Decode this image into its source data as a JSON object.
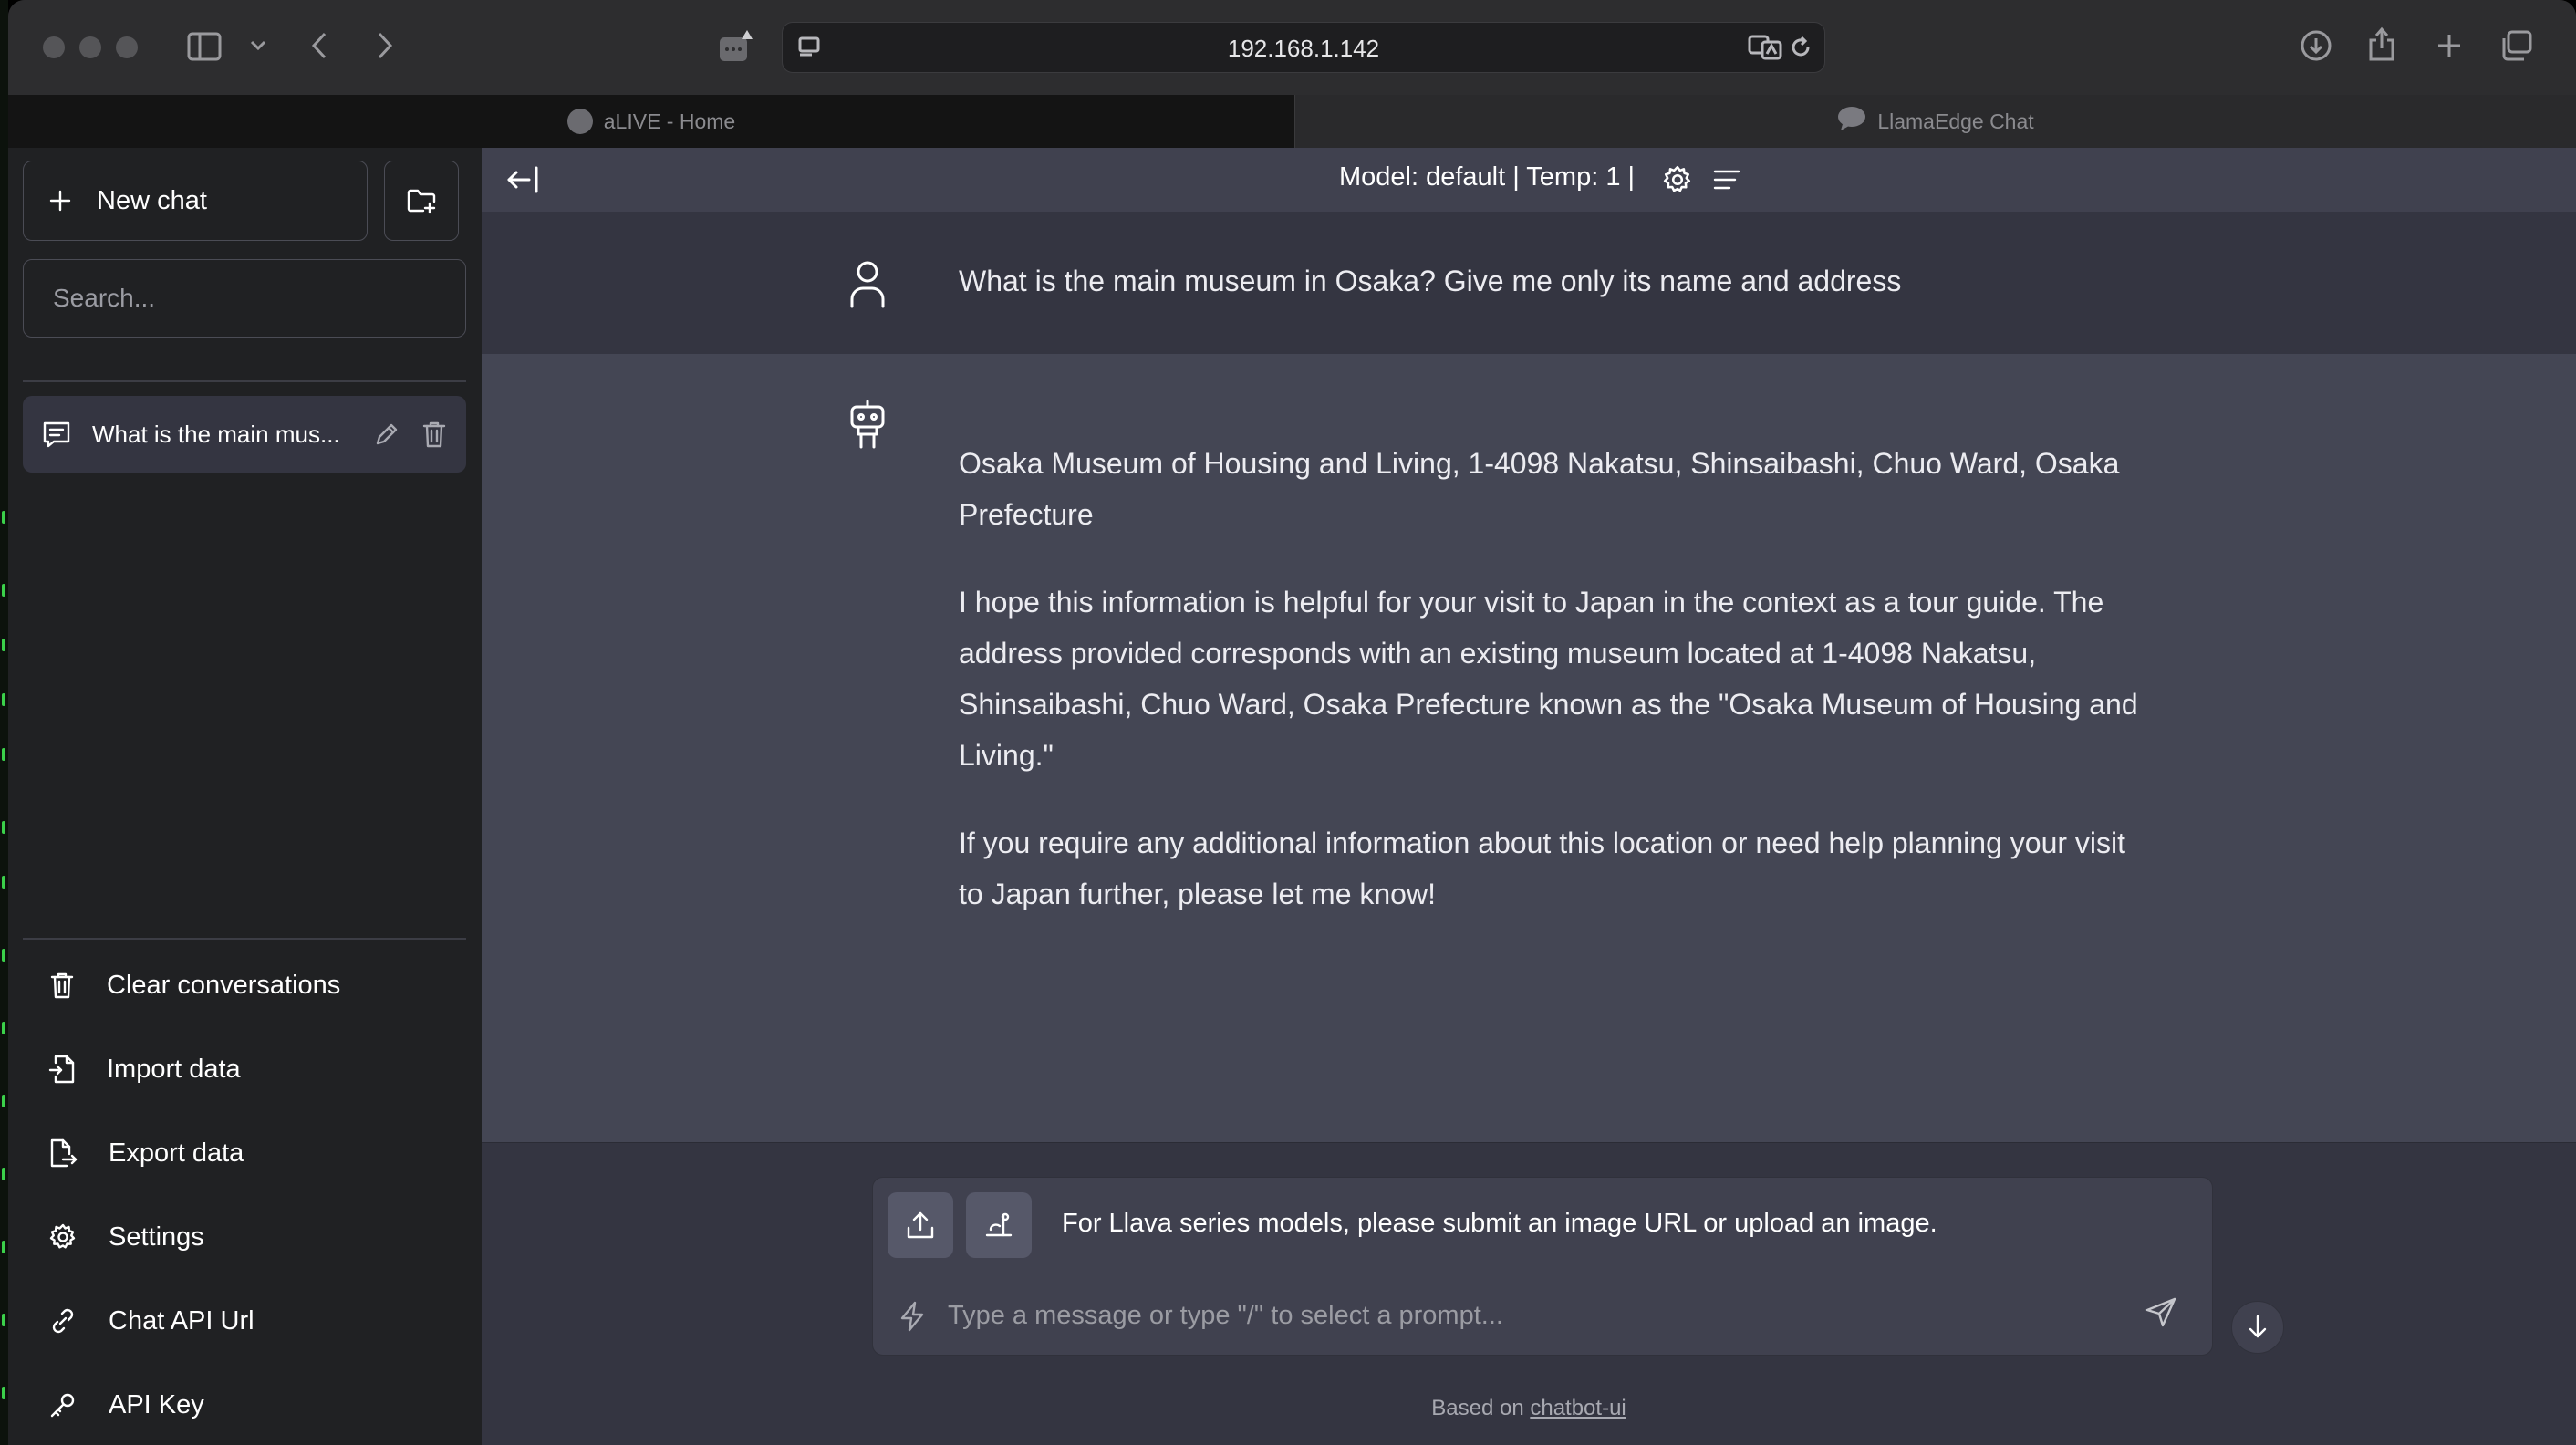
{
  "browser": {
    "url": "192.168.1.142",
    "tabs": [
      {
        "title": "aLIVE - Home",
        "active": true
      },
      {
        "title": "LlamaEdge Chat",
        "active": false
      }
    ]
  },
  "sidebar": {
    "new_chat_label": "New chat",
    "search_placeholder": "Search...",
    "conversations": [
      {
        "title": "What is the main mus..."
      }
    ],
    "menu": [
      {
        "label": "Clear conversations",
        "icon": "trash-icon"
      },
      {
        "label": "Import data",
        "icon": "file-import-icon"
      },
      {
        "label": "Export data",
        "icon": "file-export-icon"
      },
      {
        "label": "Settings",
        "icon": "gear-icon"
      },
      {
        "label": "Chat API Url",
        "icon": "link-icon"
      },
      {
        "label": "API Key",
        "icon": "key-icon"
      }
    ]
  },
  "header": {
    "model_info": "Model: default | Temp: 1 |"
  },
  "messages": {
    "user": "What is the main museum in Osaka? Give me only its name and address",
    "assistant": [
      "Osaka Museum of Housing and Living, 1-4098 Nakatsu, Shinsaibashi, Chuo Ward, Osaka Prefecture",
      "I hope this information is helpful for your visit to Japan in the context as a tour guide. The address provided corresponds with an existing museum located at 1-4098 Nakatsu, Shinsaibashi, Chuo Ward, Osaka Prefecture known as the \"Osaka Museum of Housing and Living.\"",
      "If you require any additional information about this location or need help planning your visit to Japan further, please let me know!"
    ]
  },
  "composer": {
    "llava_notice": "For Llava series models, please submit an image URL or upload an image.",
    "input_placeholder": "Type a message or type \"/\" to select a prompt..."
  },
  "footer": {
    "prefix": "Based on",
    "link_text": "chatbot-ui"
  },
  "colors": {
    "sidebar_bg": "#202123",
    "main_bg": "#343541",
    "assistant_bg": "#444654",
    "topbar_bg": "#40414f"
  }
}
